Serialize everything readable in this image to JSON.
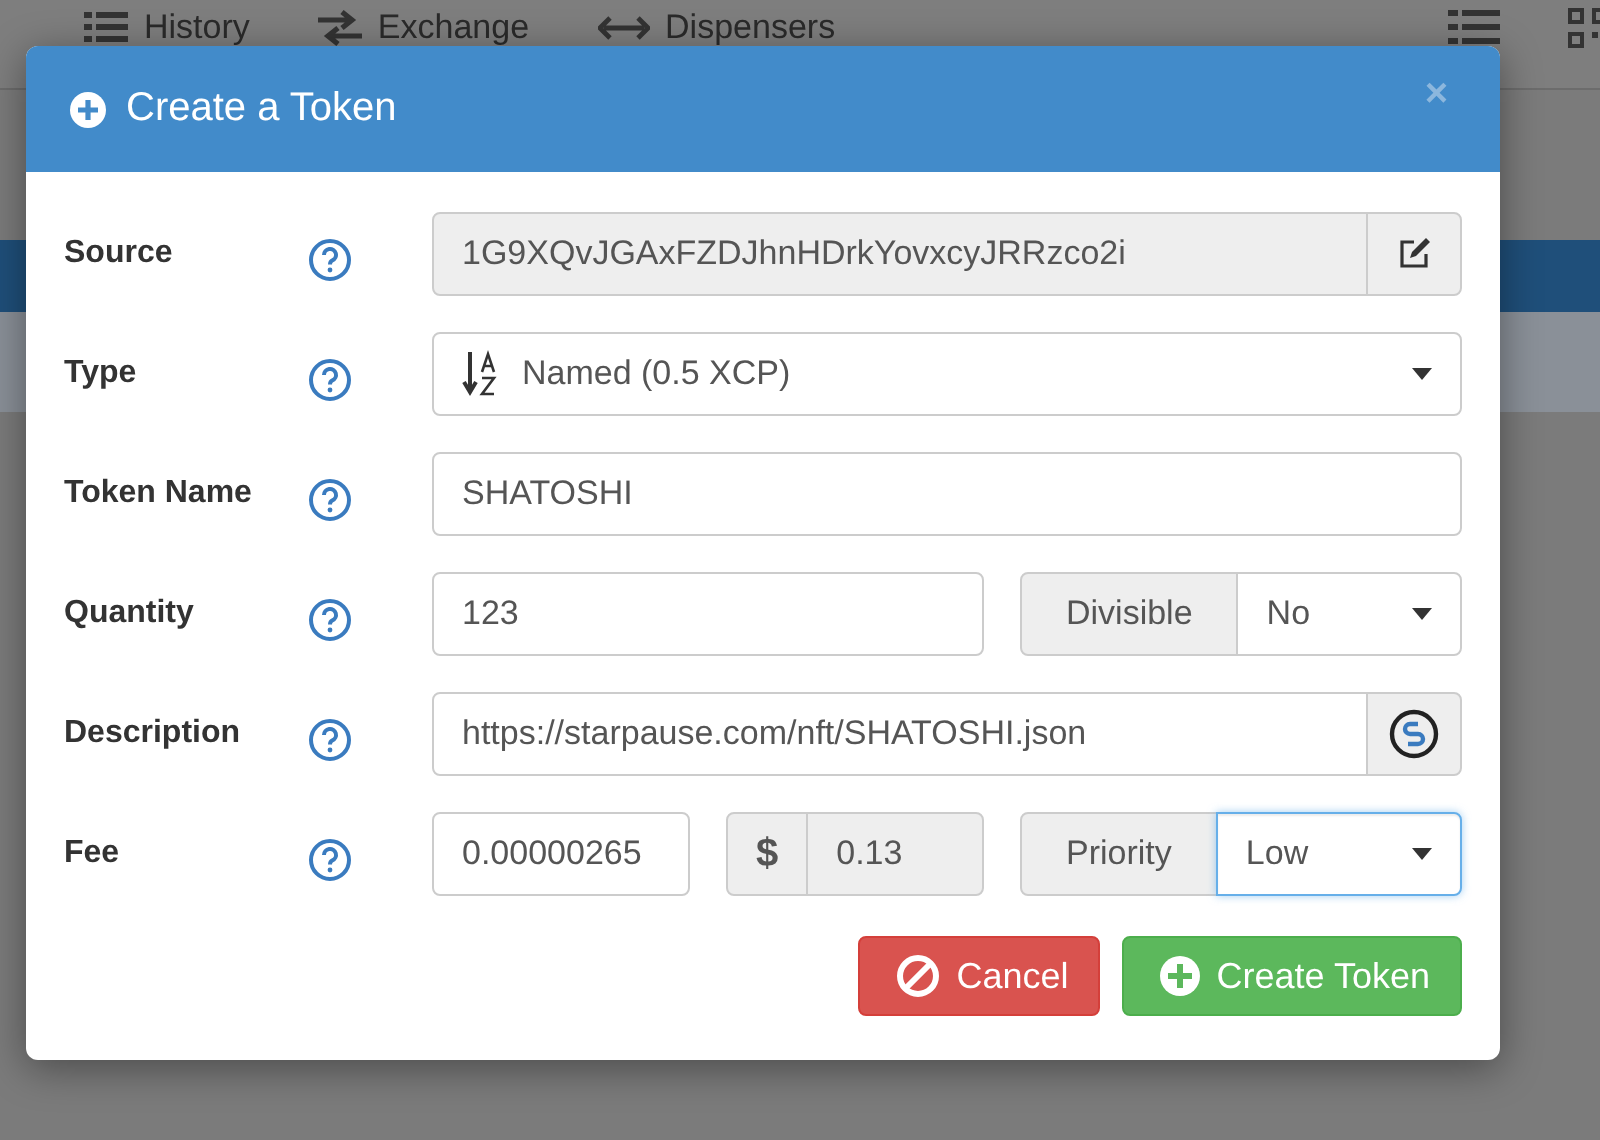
{
  "background": {
    "nav": [
      {
        "label": "History"
      },
      {
        "label": "Exchange"
      },
      {
        "label": "Dispensers"
      }
    ]
  },
  "modal": {
    "title": "Create a Token",
    "close": "×",
    "rows": [
      {
        "label": "Source",
        "groups": [
          [
            {
              "kind": "readonly-input",
              "value": "1G9XQvJGAxFZDJhnHDrkYovxcyJRRzco2i"
            },
            {
              "kind": "edit-button"
            }
          ]
        ]
      },
      {
        "label": "Type",
        "groups": [
          [
            {
              "kind": "select",
              "value": "Named (0.5 XCP)",
              "sort_icon": true,
              "focused": false
            }
          ]
        ]
      },
      {
        "label": "Token Name",
        "groups": [
          [
            {
              "kind": "input",
              "value": "SHATOSHI"
            }
          ]
        ]
      },
      {
        "label": "Quantity",
        "groups": [
          [
            {
              "kind": "input",
              "value": "123"
            }
          ],
          [
            {
              "kind": "addon",
              "text": "Divisible"
            },
            {
              "kind": "select",
              "value": "No",
              "sort_icon": false,
              "focused": false
            }
          ]
        ]
      },
      {
        "label": "Description",
        "groups": [
          [
            {
              "kind": "input",
              "value": "https://starpause.com/nft/SHATOSHI.json"
            },
            {
              "kind": "link-button"
            }
          ]
        ]
      },
      {
        "label": "Fee",
        "groups": [
          [
            {
              "kind": "input",
              "value": "0.00000265"
            }
          ],
          [
            {
              "kind": "addon",
              "text": "$"
            },
            {
              "kind": "readonly-input",
              "value": "0.13"
            }
          ],
          [
            {
              "kind": "addon",
              "text": "Priority"
            },
            {
              "kind": "select",
              "value": "Low",
              "sort_icon": false,
              "focused": true
            }
          ]
        ]
      }
    ],
    "buttons": [
      {
        "kind": "cancel",
        "label": "Cancel"
      },
      {
        "kind": "create",
        "label": "Create Token"
      }
    ]
  }
}
